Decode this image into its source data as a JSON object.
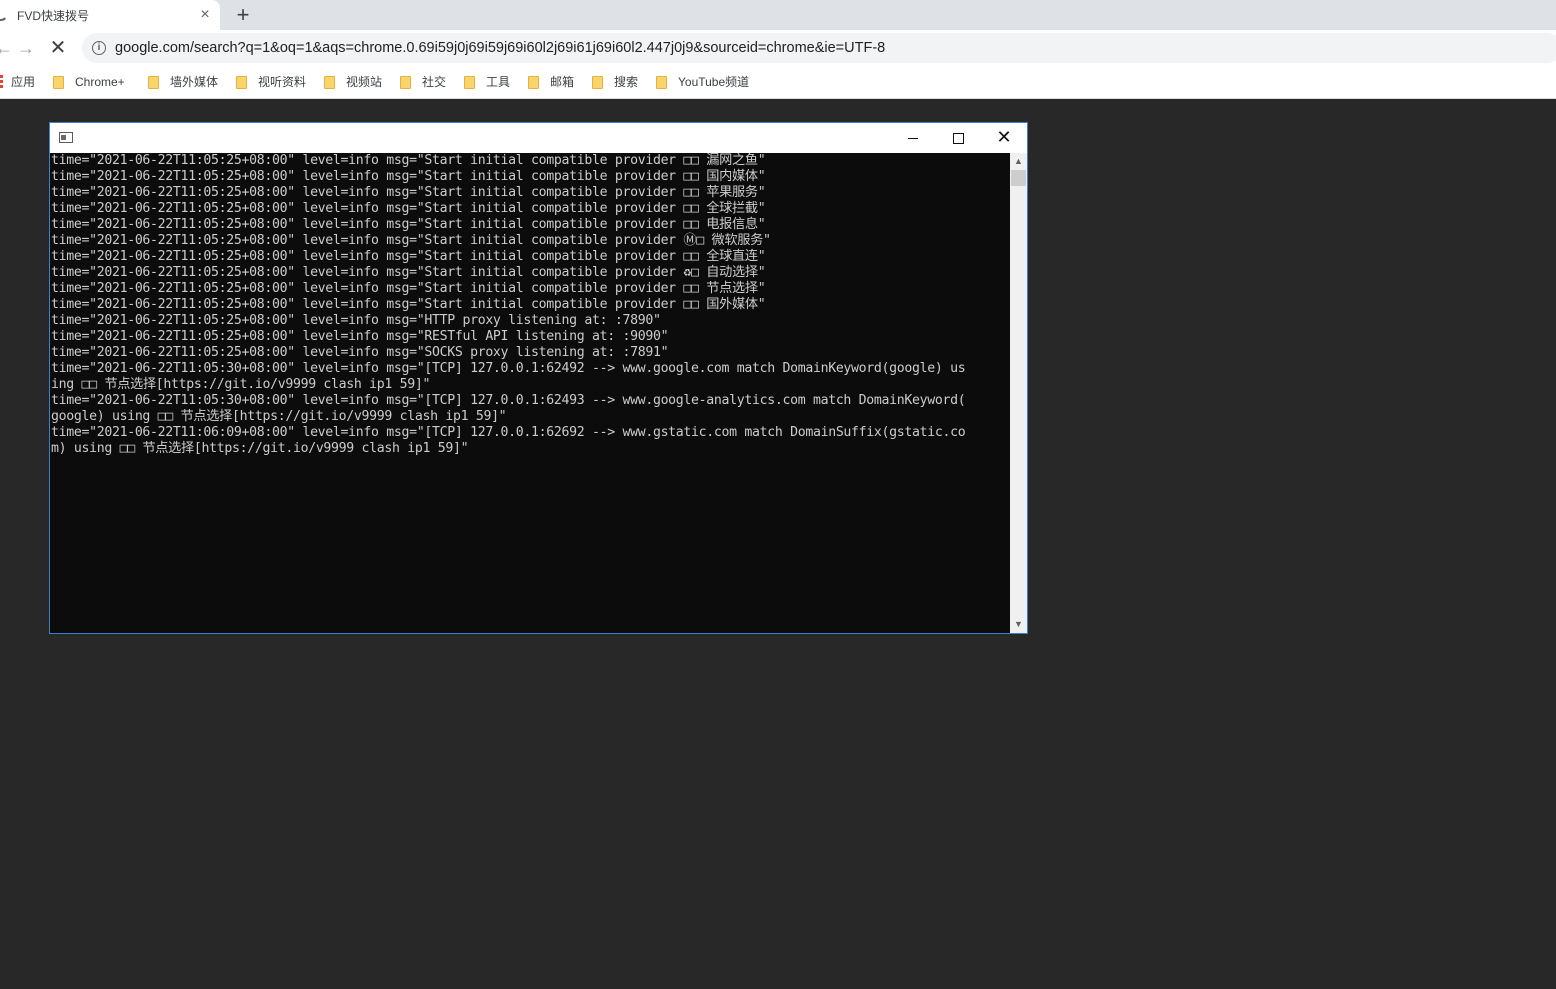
{
  "browser": {
    "tab_title": "FVD快速拨号",
    "tab_close": "×",
    "new_tab": "+",
    "back": "←",
    "forward": "→",
    "stop": "✕",
    "url_info": "i",
    "url": "google.com/search?q=1&oq=1&aqs=chrome.0.69i59j0j69i59j69i60l2j69i61j69i60l2.447j0j9&sourceid=chrome&ie=UTF-8"
  },
  "bookmarks": [
    {
      "label": "应用",
      "icon": "apps-icon"
    },
    {
      "label": "Chrome+",
      "icon": "folder-icon"
    },
    {
      "label": "墙外媒体",
      "icon": "folder-icon"
    },
    {
      "label": "视听资料",
      "icon": "folder-icon"
    },
    {
      "label": "视频站",
      "icon": "folder-icon"
    },
    {
      "label": "社交",
      "icon": "folder-icon"
    },
    {
      "label": "工具",
      "icon": "folder-icon"
    },
    {
      "label": "邮箱",
      "icon": "folder-icon"
    },
    {
      "label": "搜索",
      "icon": "folder-icon"
    },
    {
      "label": "YouTube频道",
      "icon": "folder-icon"
    }
  ],
  "console": {
    "window_icon": "console-app-icon",
    "scroll_up": "▲",
    "scroll_down": "▼",
    "lines": [
      "time=\"2021-06-22T11:05:25+08:00\" level=info msg=\"Start initial compatible provider □□ 漏网之鱼\"",
      "time=\"2021-06-22T11:05:25+08:00\" level=info msg=\"Start initial compatible provider □□ 国内媒体\"",
      "time=\"2021-06-22T11:05:25+08:00\" level=info msg=\"Start initial compatible provider □□ 苹果服务\"",
      "time=\"2021-06-22T11:05:25+08:00\" level=info msg=\"Start initial compatible provider □□ 全球拦截\"",
      "time=\"2021-06-22T11:05:25+08:00\" level=info msg=\"Start initial compatible provider □□ 电报信息\"",
      "time=\"2021-06-22T11:05:25+08:00\" level=info msg=\"Start initial compatible provider Ⓜ□ 微软服务\"",
      "time=\"2021-06-22T11:05:25+08:00\" level=info msg=\"Start initial compatible provider □□ 全球直连\"",
      "time=\"2021-06-22T11:05:25+08:00\" level=info msg=\"Start initial compatible provider ♻□ 自动选择\"",
      "time=\"2021-06-22T11:05:25+08:00\" level=info msg=\"Start initial compatible provider □□ 节点选择\"",
      "time=\"2021-06-22T11:05:25+08:00\" level=info msg=\"Start initial compatible provider □□ 国外媒体\"",
      "time=\"2021-06-22T11:05:25+08:00\" level=info msg=\"HTTP proxy listening at: :7890\"",
      "time=\"2021-06-22T11:05:25+08:00\" level=info msg=\"RESTful API listening at: :9090\"",
      "time=\"2021-06-22T11:05:25+08:00\" level=info msg=\"SOCKS proxy listening at: :7891\"",
      "time=\"2021-06-22T11:05:30+08:00\" level=info msg=\"[TCP] 127.0.0.1:62492 --> www.google.com match DomainKeyword(google) us",
      "ing □□ 节点选择[https://git.io/v9999 clash ip1 59]\"",
      "time=\"2021-06-22T11:05:30+08:00\" level=info msg=\"[TCP] 127.0.0.1:62493 --> www.google-analytics.com match DomainKeyword(",
      "google) using □□ 节点选择[https://git.io/v9999 clash ip1 59]\"",
      "time=\"2021-06-22T11:06:09+08:00\" level=info msg=\"[TCP] 127.0.0.1:62692 --> www.gstatic.com match DomainSuffix(gstatic.co",
      "m) using □□ 节点选择[https://git.io/v9999 clash ip1 59]\""
    ]
  },
  "colors": {
    "desktop": "#282828",
    "console_bg": "#0c0c0c",
    "console_text": "#cccccc",
    "window_border": "#3d80c9"
  }
}
